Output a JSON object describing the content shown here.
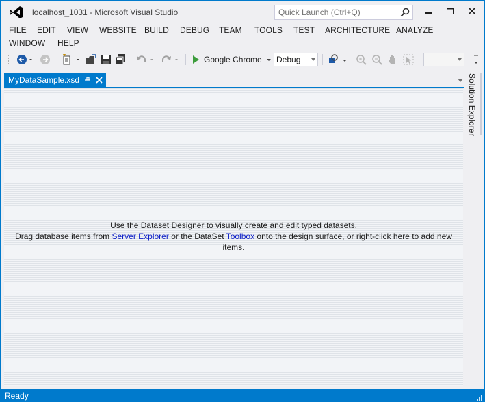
{
  "window": {
    "title": "localhost_1031 - Microsoft Visual Studio",
    "quick_launch_placeholder": "Quick Launch (Ctrl+Q)"
  },
  "menu": [
    "FILE",
    "EDIT",
    "VIEW",
    "WEBSITE",
    "BUILD",
    "DEBUG",
    "TEAM",
    "TOOLS",
    "TEST",
    "ARCHITECTURE",
    "ANALYZE",
    "WINDOW",
    "HELP"
  ],
  "toolbar": {
    "run_target": "Google Chrome",
    "configuration": "Debug"
  },
  "document_tab": {
    "label": "MyDataSample.xsd"
  },
  "designer": {
    "line1": "Use the Dataset Designer to visually create and edit typed datasets.",
    "line2_a": "Drag database items from ",
    "link_server_explorer": "Server Explorer",
    "line2_b": " or the DataSet ",
    "link_toolbox": "Toolbox",
    "line2_c": " onto the design surface, or right-click here to add new items."
  },
  "side_panel": {
    "label": "Solution Explorer"
  },
  "status": {
    "text": "Ready"
  },
  "colors": {
    "accent": "#007acc",
    "link": "#0e20c8"
  }
}
